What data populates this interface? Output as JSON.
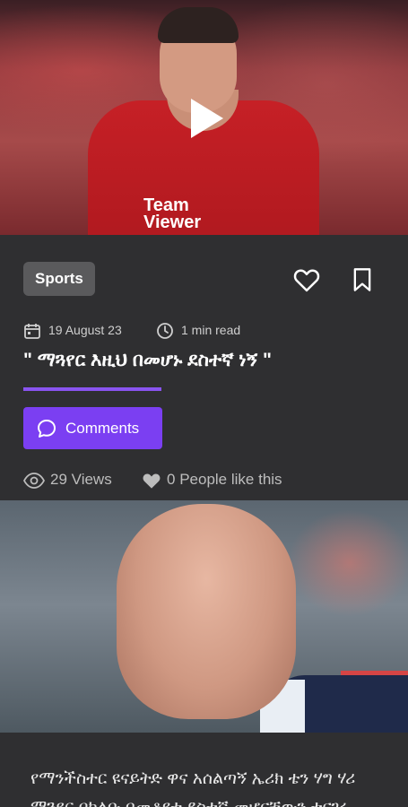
{
  "article1": {
    "category": "Sports",
    "date": "19 August 23",
    "read_time": "1 min read",
    "title": "\" ማጓየር እዚህ በመሆኑ ደስተኛ ነኝ \"",
    "comments_label": "Comments",
    "views_count": "29",
    "views_label": "Views",
    "likes_count": "0",
    "likes_label": "People like this",
    "image_text": "Team Viewer"
  },
  "article2": {
    "excerpt": "የማንችስተር ዩናይትድ ዋና አሰልጣኝ ኤሪክ ቴን ሃግ ሃሪ ማጓየር በክለቡ በመቆየቱ ደስተኛ መሆናቸውን ተናገሩ"
  },
  "colors": {
    "background": "#2f2f31",
    "chip": "#5a5a5c",
    "accent": "#7b3ff2",
    "underline": "#8a54f0"
  }
}
